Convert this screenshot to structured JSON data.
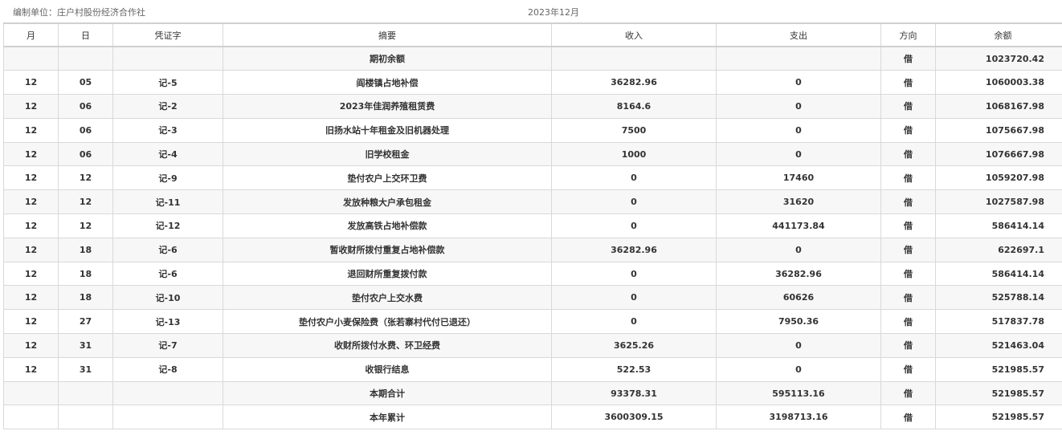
{
  "header": {
    "unit_label": "编制单位：庄户村股份经济合作社",
    "period": "2023年12月"
  },
  "columns": [
    "月",
    "日",
    "凭证字",
    "摘要",
    "收入",
    "支出",
    "方向",
    "余额"
  ],
  "rows": [
    {
      "month": "",
      "day": "",
      "voucher": "",
      "summary": "期初余额",
      "income": "",
      "expense": "",
      "direction": "借",
      "balance": "1023720.42"
    },
    {
      "month": "12",
      "day": "05",
      "voucher": "记-5",
      "summary": "阎楼镇占地补偿",
      "income": "36282.96",
      "expense": "0",
      "direction": "借",
      "balance": "1060003.38"
    },
    {
      "month": "12",
      "day": "06",
      "voucher": "记-2",
      "summary": "2023年佳润养殖租赁费",
      "income": "8164.6",
      "expense": "0",
      "direction": "借",
      "balance": "1068167.98"
    },
    {
      "month": "12",
      "day": "06",
      "voucher": "记-3",
      "summary": "旧扬水站十年租金及旧机器处理",
      "income": "7500",
      "expense": "0",
      "direction": "借",
      "balance": "1075667.98"
    },
    {
      "month": "12",
      "day": "06",
      "voucher": "记-4",
      "summary": "旧学校租金",
      "income": "1000",
      "expense": "0",
      "direction": "借",
      "balance": "1076667.98"
    },
    {
      "month": "12",
      "day": "12",
      "voucher": "记-9",
      "summary": "垫付农户上交环卫费",
      "income": "0",
      "expense": "17460",
      "direction": "借",
      "balance": "1059207.98"
    },
    {
      "month": "12",
      "day": "12",
      "voucher": "记-11",
      "summary": "发放种粮大户承包租金",
      "income": "0",
      "expense": "31620",
      "direction": "借",
      "balance": "1027587.98"
    },
    {
      "month": "12",
      "day": "12",
      "voucher": "记-12",
      "summary": "发放高铁占地补偿款",
      "income": "0",
      "expense": "441173.84",
      "direction": "借",
      "balance": "586414.14"
    },
    {
      "month": "12",
      "day": "18",
      "voucher": "记-6",
      "summary": "暂收财所拨付重复占地补偿款",
      "income": "36282.96",
      "expense": "0",
      "direction": "借",
      "balance": "622697.1"
    },
    {
      "month": "12",
      "day": "18",
      "voucher": "记-6",
      "summary": "退回财所重复拨付款",
      "income": "0",
      "expense": "36282.96",
      "direction": "借",
      "balance": "586414.14"
    },
    {
      "month": "12",
      "day": "18",
      "voucher": "记-10",
      "summary": "垫付农户上交水费",
      "income": "0",
      "expense": "60626",
      "direction": "借",
      "balance": "525788.14"
    },
    {
      "month": "12",
      "day": "27",
      "voucher": "记-13",
      "summary": "垫付农户小麦保险费（张若寨村代付已退还）",
      "income": "0",
      "expense": "7950.36",
      "direction": "借",
      "balance": "517837.78"
    },
    {
      "month": "12",
      "day": "31",
      "voucher": "记-7",
      "summary": "收财所拨付水费、环卫经费",
      "income": "3625.26",
      "expense": "0",
      "direction": "借",
      "balance": "521463.04"
    },
    {
      "month": "12",
      "day": "31",
      "voucher": "记-8",
      "summary": "收银行结息",
      "income": "522.53",
      "expense": "0",
      "direction": "借",
      "balance": "521985.57"
    },
    {
      "month": "",
      "day": "",
      "voucher": "",
      "summary": "本期合计",
      "income": "93378.31",
      "expense": "595113.16",
      "direction": "借",
      "balance": "521985.57"
    },
    {
      "month": "",
      "day": "",
      "voucher": "",
      "summary": "本年累计",
      "income": "3600309.15",
      "expense": "3198713.16",
      "direction": "借",
      "balance": "521985.57"
    }
  ]
}
